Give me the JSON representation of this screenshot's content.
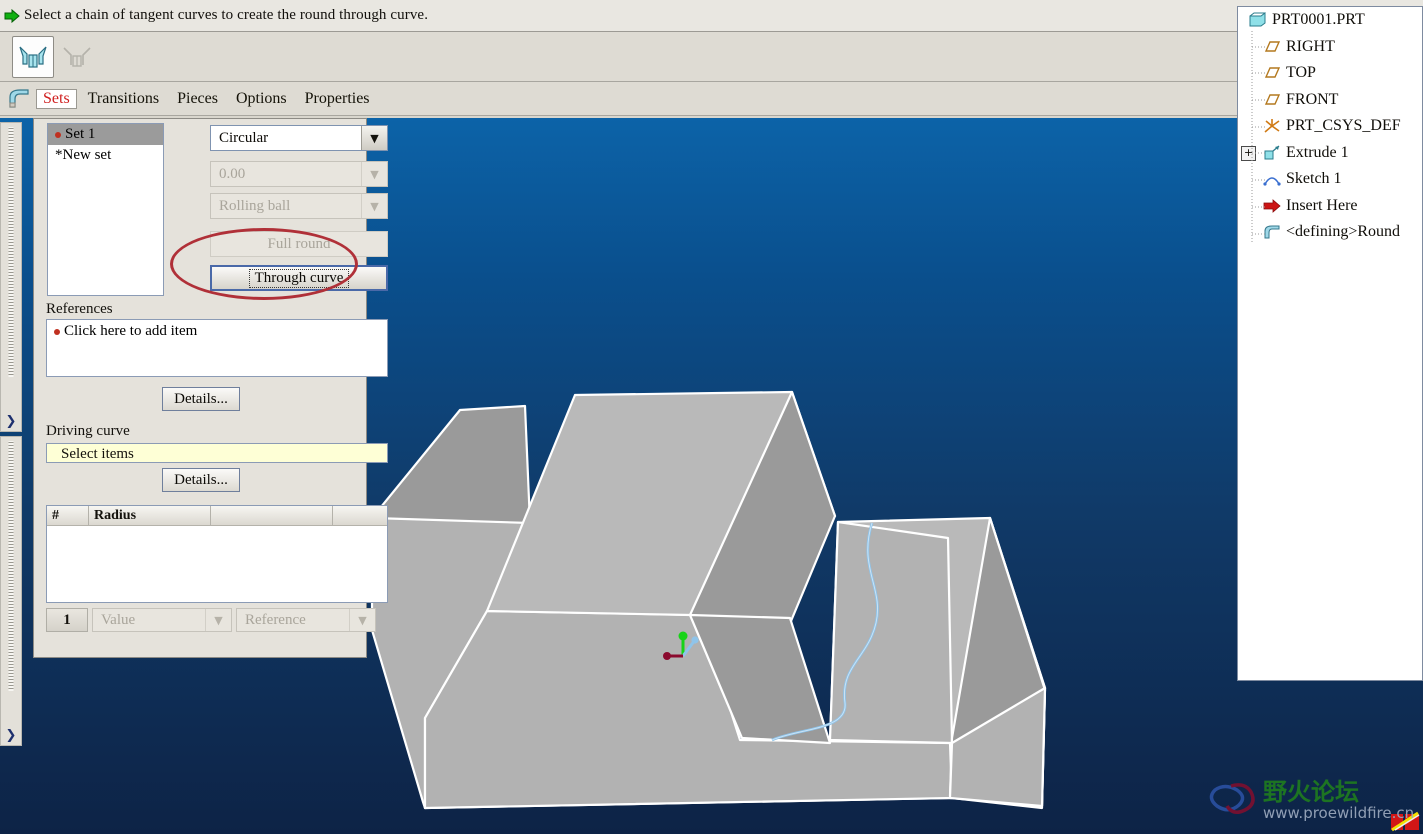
{
  "message_bar": {
    "icon": "green-arrow-icon",
    "text": "Select a chain of tangent curves to create the round through curve."
  },
  "icon_toolbar": {
    "buttons": [
      {
        "name": "round-transition-sets-icon",
        "state": "selected"
      },
      {
        "name": "round-transitions-icon",
        "state": "disabled"
      }
    ]
  },
  "tab_bar": {
    "feature_icon": "round-feature-icon",
    "tabs": [
      {
        "label": "Sets",
        "active": true
      },
      {
        "label": "Transitions",
        "active": false
      },
      {
        "label": "Pieces",
        "active": false
      },
      {
        "label": "Options",
        "active": false
      },
      {
        "label": "Properties",
        "active": false
      }
    ]
  },
  "panel": {
    "set_list": [
      {
        "label": "Set 1",
        "selected": true,
        "bullet": true
      },
      {
        "label": "*New set",
        "selected": false,
        "bullet": false
      }
    ],
    "shape_dropdown": {
      "value": "Circular",
      "enabled": true
    },
    "radius_dropdown": {
      "value": "0.00",
      "enabled": false
    },
    "creation_dropdown": {
      "value": "Rolling ball",
      "enabled": false
    },
    "full_round_button": {
      "label": "Full round",
      "enabled": false
    },
    "through_curve_button": {
      "label": "Through curve",
      "enabled": true,
      "focused": true
    },
    "references_label": "References",
    "references_items": [
      {
        "label": "Click here to add item",
        "bullet": true
      }
    ],
    "references_details_button": "Details...",
    "driving_curve_label": "Driving curve",
    "driving_curve_value": "Select items",
    "driving_curve_details_button": "Details...",
    "radius_table": {
      "columns": [
        "#",
        "Radius",
        "",
        ""
      ],
      "rows": []
    },
    "row_number": "1",
    "value_dropdown": {
      "value": "Value",
      "enabled": false
    },
    "reference_dropdown": {
      "value": "Reference",
      "enabled": false
    }
  },
  "annotation": {
    "shape": "red-ellipse-highlight",
    "color": "#b03038",
    "targets": [
      "Full round",
      "Through curve"
    ]
  },
  "model_tree": {
    "items": [
      {
        "label": "PRT0001.PRT",
        "icon": "part-icon",
        "indent": 0,
        "expander": false
      },
      {
        "label": "RIGHT",
        "icon": "datum-plane-icon",
        "indent": 1,
        "expander": false
      },
      {
        "label": "TOP",
        "icon": "datum-plane-icon",
        "indent": 1,
        "expander": false
      },
      {
        "label": "FRONT",
        "icon": "datum-plane-icon",
        "indent": 1,
        "expander": false
      },
      {
        "label": "PRT_CSYS_DEF",
        "icon": "coordinate-system-icon",
        "indent": 1,
        "expander": false
      },
      {
        "label": "Extrude 1",
        "icon": "extrude-icon",
        "indent": 1,
        "expander": true
      },
      {
        "label": "Sketch 1",
        "icon": "sketch-icon",
        "indent": 1,
        "expander": false
      },
      {
        "label": "Insert Here",
        "icon": "insert-here-arrow-icon",
        "indent": 1,
        "expander": false
      },
      {
        "label": "<defining>Round",
        "icon": "round-feature-icon",
        "indent": 1,
        "expander": false
      }
    ],
    "corner_icon": "regenerate-failed-icon"
  },
  "viewport": {
    "background_top_color": "#0c63a8",
    "background_bottom_color": "#0d2346",
    "model_face_color": "#b3b3b3",
    "model_edge_color": "#ffffff",
    "sketch_curve_color": "#8fc4ea",
    "triad": {
      "x_axis_color": "#8b0a2e",
      "y_axis_color": "#18d318",
      "z_axis_color": "#8fc4ea"
    }
  },
  "watermark": {
    "title": "野火论坛",
    "url": "www.proewildfire.cn",
    "title_color": "#1f7a1f",
    "url_color": "#9aa8bd"
  },
  "left_toolbars": {
    "chevron": "❯",
    "items": [
      {
        "name": "left-toolbar-upper"
      },
      {
        "name": "left-toolbar-lower"
      }
    ]
  }
}
